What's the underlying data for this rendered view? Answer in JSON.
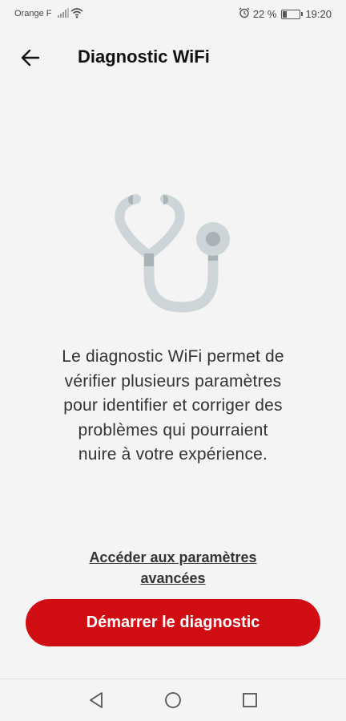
{
  "status_bar": {
    "carrier": "Orange F",
    "battery_percent": "22 %",
    "battery_level": 0.22,
    "time": "19:20",
    "icons": [
      "signal-icon",
      "wifi-icon",
      "alarm-icon",
      "battery-icon"
    ]
  },
  "header": {
    "title": "Diagnostic WiFi",
    "back_icon": "back-arrow-icon"
  },
  "illustration": {
    "icon": "stethoscope-icon"
  },
  "main": {
    "description_lines": [
      "Le diagnostic WiFi permet de",
      "vérifier plusieurs paramètres",
      "pour identifier et corriger des",
      "problèmes qui pourraient",
      "nuire à votre expérience."
    ],
    "advanced_link_lines": [
      "Accéder aux paramètres",
      "avancées"
    ],
    "start_button_label": "Démarrer le diagnostic"
  },
  "nav_bar": {
    "icons": [
      "back-triangle-icon",
      "home-circle-icon",
      "recents-square-icon"
    ]
  },
  "colors": {
    "accent": "#d00d12",
    "background": "#f4f4f4",
    "illustration_light": "#ced5d8",
    "illustration_dark": "#a9b3b7"
  }
}
